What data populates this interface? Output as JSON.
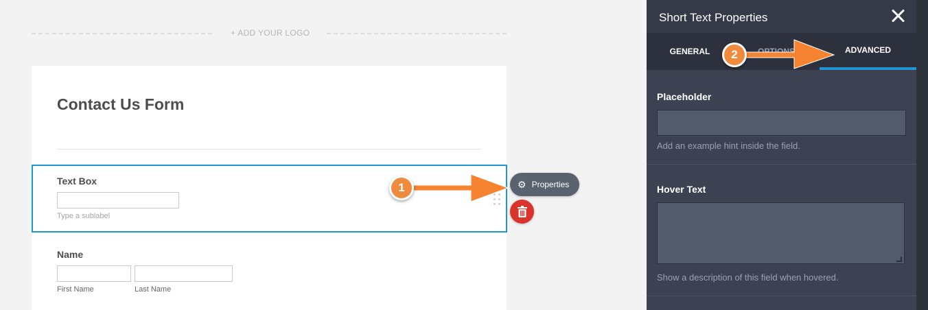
{
  "logo": {
    "text": "+ ADD YOUR LOGO"
  },
  "form": {
    "title": "Contact Us Form",
    "textbox": {
      "label": "Text Box",
      "sublabel": "Type a sublabel"
    },
    "name": {
      "label": "Name",
      "first_label": "First Name",
      "last_label": "Last Name"
    }
  },
  "actions": {
    "properties_label": "Properties",
    "properties_icon": "gear-icon",
    "delete_icon": "trash-icon"
  },
  "markers": {
    "one": "1",
    "two": "2"
  },
  "panel": {
    "title": "Short Text Properties",
    "tabs": {
      "general": "GENERAL",
      "options": "OPTIONS",
      "advanced": "ADVANCED"
    },
    "placeholder": {
      "label": "Placeholder",
      "hint": "Add an example hint inside the field."
    },
    "hover": {
      "label": "Hover Text",
      "hint": "Show a description of this field when hovered."
    }
  },
  "colors": {
    "accent": "#1f96d3",
    "marker": "#f08a3c",
    "delete": "#d9342b",
    "panel": "#3c4252"
  }
}
